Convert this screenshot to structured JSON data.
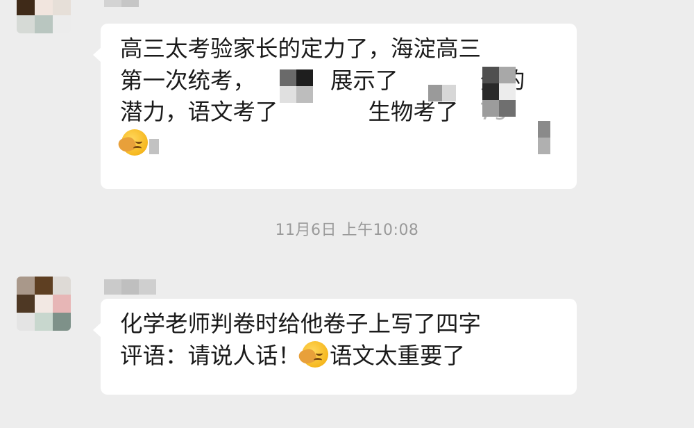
{
  "messages": [
    {
      "lines": [
        "高三太考验家长的定力了，海淀高三",
        "第一次统考，",
        "展示了",
        "分的",
        "潜力，语文考了",
        "生物考了",
        "79"
      ]
    },
    {
      "lines": [
        "化学老师判卷时给他卷子上写了四字",
        "评语：请说人话！",
        "语文太重要了"
      ]
    }
  ],
  "timestamp": "11月6日 上午10:08",
  "icons": {
    "emoji": "facepalm-emoji-icon",
    "avatar": "pixelated-avatar"
  }
}
